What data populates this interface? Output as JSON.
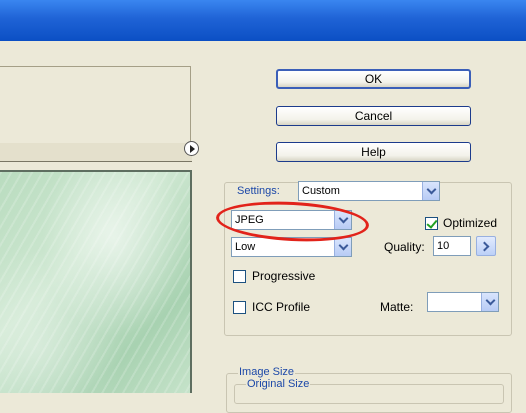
{
  "buttons": {
    "ok": "OK",
    "cancel": "Cancel",
    "help": "Help"
  },
  "settings": {
    "label": "Settings:",
    "value": "Custom"
  },
  "format": {
    "value": "JPEG"
  },
  "optimized": {
    "label": "Optimized",
    "checked": true
  },
  "quality_level": {
    "value": "Low"
  },
  "quality": {
    "label": "Quality:",
    "value": "10"
  },
  "progressive": {
    "label": "Progressive",
    "checked": false
  },
  "icc_profile": {
    "label": "ICC Profile",
    "checked": false
  },
  "matte": {
    "label": "Matte:",
    "value": ""
  },
  "image_size": {
    "legend": "Image Size",
    "original_legend": "Original Size"
  },
  "annotation": {
    "color": "#e2231a"
  }
}
